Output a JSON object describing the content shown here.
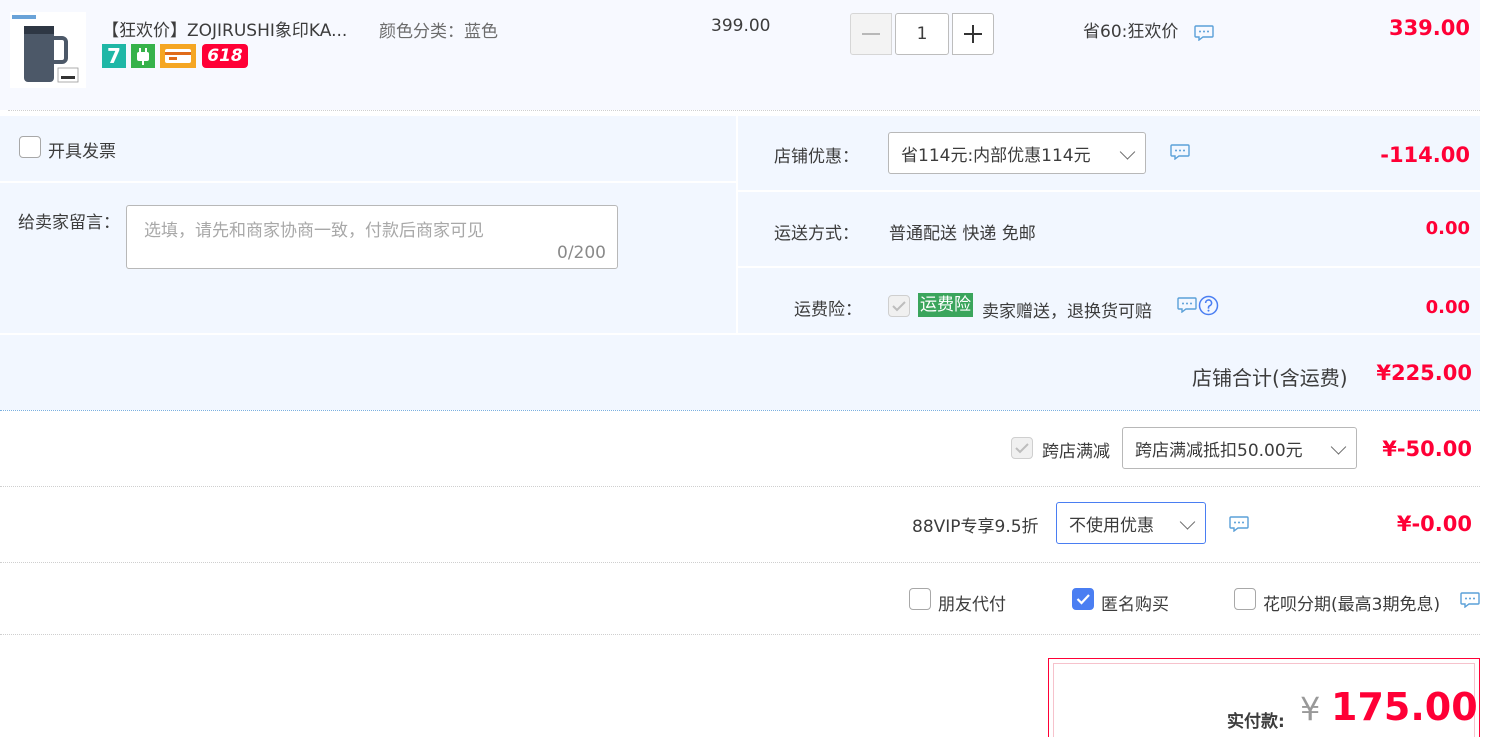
{
  "item": {
    "title": "【狂欢价】ZOJIRUSHI象印KA...",
    "sku": "颜色分类：蓝色",
    "unit_price": "399.00",
    "quantity": "1",
    "promo_text": "省60:狂欢价",
    "subtotal": "339.00",
    "badges": [
      "7",
      "plug",
      "card",
      "618"
    ]
  },
  "invoice": {
    "label": "开具发票"
  },
  "note": {
    "label": "给卖家留言：",
    "placeholder": "选填，请先和商家协商一致，付款后商家可见",
    "counter": "0/200"
  },
  "store_discount": {
    "label": "店铺优惠：",
    "selected": "省114元:内部优惠114元",
    "amount": "-114.00"
  },
  "shipping": {
    "label": "运送方式：",
    "value": "普通配送 快递 免邮",
    "amount": "0.00"
  },
  "freight_insurance": {
    "label": "运费险：",
    "tag": "运费险",
    "text": "卖家赠送，退换货可赔",
    "amount": "0.00"
  },
  "store_total": {
    "label": "店铺合计(含运费)",
    "amount": "¥225.00"
  },
  "cross_store": {
    "label": "跨店满减",
    "selected": "跨店满减抵扣50.00元",
    "amount": "¥-50.00"
  },
  "vip": {
    "label": "88VIP专享9.5折",
    "selected": "不使用优惠",
    "amount": "¥-0.00"
  },
  "options": [
    {
      "label": "朋友代付",
      "checked": false
    },
    {
      "label": "匿名购买",
      "checked": true
    },
    {
      "label": "花呗分期(最高3期免息)",
      "checked": false
    }
  ],
  "payment": {
    "label": "实付款:",
    "currency": "¥",
    "amount": "175.00"
  },
  "colors": {
    "price_red": "#ff0036",
    "panel_bg": "#f2f7ff",
    "checkbox_blue": "#4a7ef2",
    "insurance_green": "#3ba55c"
  }
}
